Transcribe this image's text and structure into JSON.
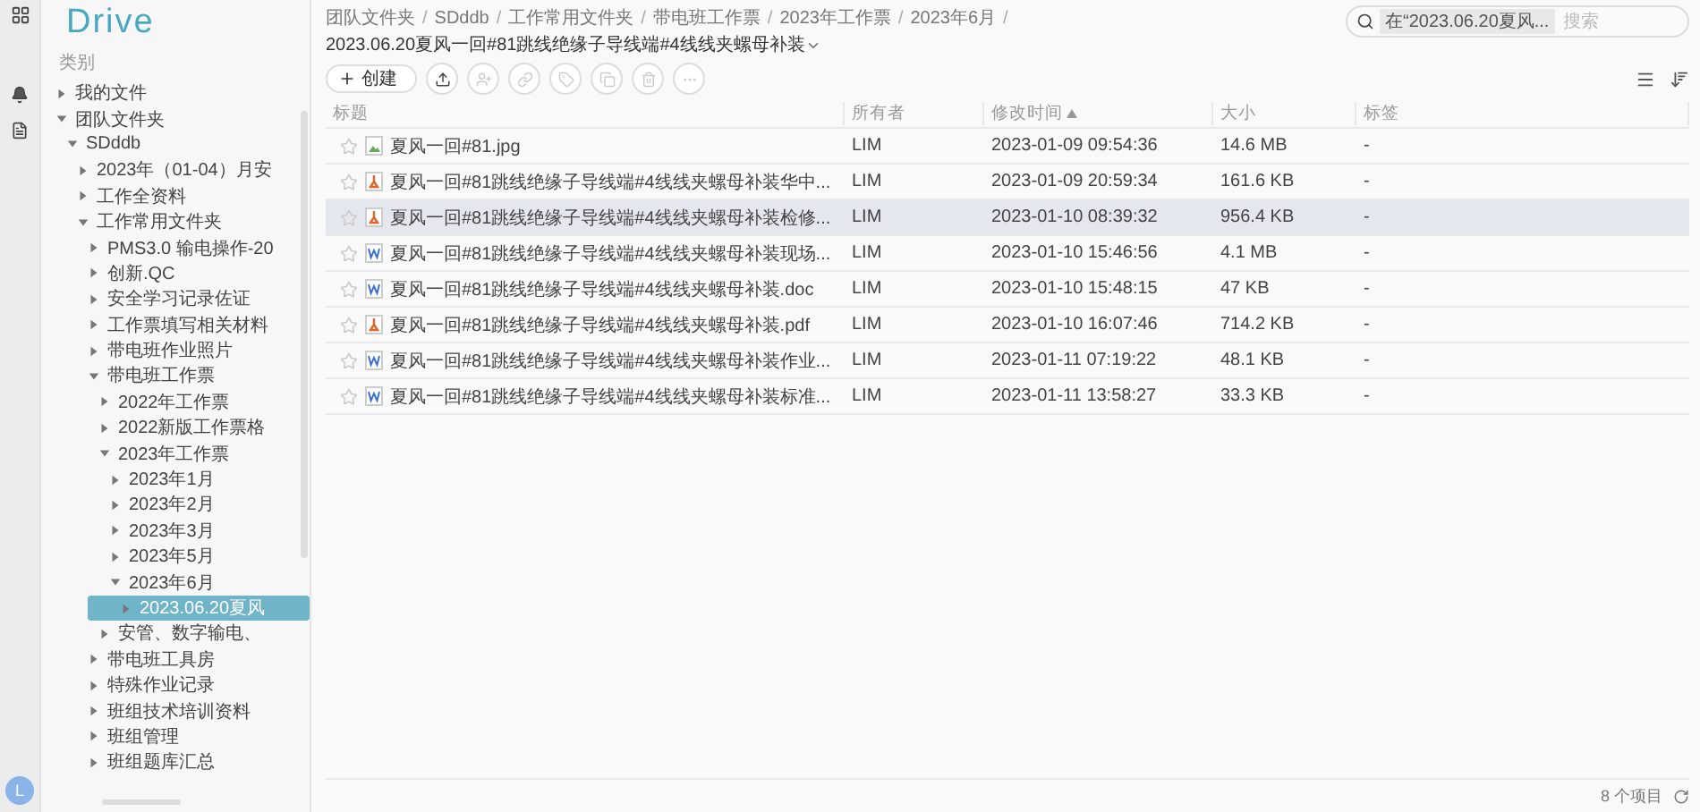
{
  "app": {
    "logo": "Drive"
  },
  "rail": {
    "avatar": "L"
  },
  "sidebar": {
    "heading": "类别",
    "tree": [
      {
        "label": "我的文件",
        "expanded": false,
        "selected": false
      },
      {
        "label": "团队文件夹",
        "expanded": true,
        "selected": false,
        "children": [
          {
            "label": "SDddb",
            "expanded": true,
            "selected": false,
            "children": [
              {
                "label": "2023年（01-04）月安",
                "expanded": false,
                "selected": false
              },
              {
                "label": "工作全资料",
                "expanded": false,
                "selected": false
              },
              {
                "label": "工作常用文件夹",
                "expanded": true,
                "selected": false,
                "children": [
                  {
                    "label": "PMS3.0 输电操作-20",
                    "expanded": false,
                    "selected": false
                  },
                  {
                    "label": "创新.QC",
                    "expanded": false,
                    "selected": false
                  },
                  {
                    "label": "安全学习记录佐证",
                    "expanded": false,
                    "selected": false
                  },
                  {
                    "label": "工作票填写相关材料",
                    "expanded": false,
                    "selected": false
                  },
                  {
                    "label": "带电班作业照片",
                    "expanded": false,
                    "selected": false
                  },
                  {
                    "label": "带电班工作票",
                    "expanded": true,
                    "selected": false,
                    "children": [
                      {
                        "label": "2022年工作票",
                        "expanded": false,
                        "selected": false
                      },
                      {
                        "label": "2022新版工作票格",
                        "expanded": false,
                        "selected": false
                      },
                      {
                        "label": "2023年工作票",
                        "expanded": true,
                        "selected": false,
                        "children": [
                          {
                            "label": "2023年1月",
                            "expanded": false,
                            "selected": false
                          },
                          {
                            "label": "2023年2月",
                            "expanded": false,
                            "selected": false
                          },
                          {
                            "label": "2023年3月",
                            "expanded": false,
                            "selected": false
                          },
                          {
                            "label": "2023年5月",
                            "expanded": false,
                            "selected": false
                          },
                          {
                            "label": "2023年6月",
                            "expanded": true,
                            "selected": false,
                            "children": [
                              {
                                "label": "2023.06.20夏风",
                                "expanded": false,
                                "selected": true
                              }
                            ]
                          }
                        ]
                      },
                      {
                        "label": "安管、数字输电、",
                        "expanded": false,
                        "selected": false
                      }
                    ]
                  },
                  {
                    "label": "带电班工具房",
                    "expanded": false,
                    "selected": false
                  },
                  {
                    "label": "特殊作业记录",
                    "expanded": false,
                    "selected": false
                  },
                  {
                    "label": "班组技术培训资料",
                    "expanded": false,
                    "selected": false
                  },
                  {
                    "label": "班组管理",
                    "expanded": false,
                    "selected": false
                  },
                  {
                    "label": "班组题库汇总",
                    "expanded": false,
                    "selected": false
                  }
                ]
              }
            ]
          }
        ]
      }
    ]
  },
  "breadcrumb": {
    "separator": "/",
    "items": [
      "团队文件夹",
      "SDddb",
      "工作常用文件夹",
      "带电班工作票",
      "2023年工作票",
      "2023年6月",
      "2023.06.20夏风一回#81跳线绝缘子导线端#4线线夹螺母补装"
    ]
  },
  "search": {
    "scope": "在“2023.06.20夏风...",
    "placeholder": "搜索"
  },
  "toolbar": {
    "create": "创建",
    "actions": [
      {
        "kind": "upload",
        "disabled": false
      },
      {
        "kind": "share",
        "disabled": true
      },
      {
        "kind": "link",
        "disabled": true
      },
      {
        "kind": "tag",
        "disabled": true
      },
      {
        "kind": "copy",
        "disabled": true
      },
      {
        "kind": "delete",
        "disabled": true
      },
      {
        "kind": "more",
        "disabled": true
      }
    ]
  },
  "table": {
    "columns": [
      {
        "label": "标题",
        "sorted": false
      },
      {
        "label": "所有者",
        "sorted": false
      },
      {
        "label": "修改时间",
        "sorted": true
      },
      {
        "label": "大小",
        "sorted": false
      },
      {
        "label": "标签",
        "sorted": false
      }
    ],
    "rows": [
      {
        "starred": false,
        "kind": "image",
        "title": "夏风一回#81.jpg",
        "owner": "LIM",
        "modified": "2023-01-09 09:54:36",
        "size": "14.6 MB",
        "tags": "-",
        "highlighted": false
      },
      {
        "starred": false,
        "kind": "pdf",
        "title": "夏风一回#81跳线绝缘子导线端#4线线夹螺母补装华中...",
        "owner": "LIM",
        "modified": "2023-01-09 20:59:34",
        "size": "161.6 KB",
        "tags": "-",
        "highlighted": false
      },
      {
        "starred": false,
        "kind": "pdf",
        "title": "夏风一回#81跳线绝缘子导线端#4线线夹螺母补装检修...",
        "owner": "LIM",
        "modified": "2023-01-10 08:39:32",
        "size": "956.4 KB",
        "tags": "-",
        "highlighted": true
      },
      {
        "starred": false,
        "kind": "word",
        "title": "夏风一回#81跳线绝缘子导线端#4线线夹螺母补装现场...",
        "owner": "LIM",
        "modified": "2023-01-10 15:46:56",
        "size": "4.1 MB",
        "tags": "-",
        "highlighted": false
      },
      {
        "starred": false,
        "kind": "word",
        "title": "夏风一回#81跳线绝缘子导线端#4线线夹螺母补装.doc",
        "owner": "LIM",
        "modified": "2023-01-10 15:48:15",
        "size": "47 KB",
        "tags": "-",
        "highlighted": false
      },
      {
        "starred": false,
        "kind": "pdf",
        "title": "夏风一回#81跳线绝缘子导线端#4线线夹螺母补装.pdf",
        "owner": "LIM",
        "modified": "2023-01-10 16:07:46",
        "size": "714.2 KB",
        "tags": "-",
        "highlighted": false
      },
      {
        "starred": false,
        "kind": "word",
        "title": "夏风一回#81跳线绝缘子导线端#4线线夹螺母补装作业...",
        "owner": "LIM",
        "modified": "2023-01-11 07:19:22",
        "size": "48.1 KB",
        "tags": "-",
        "highlighted": false
      },
      {
        "starred": false,
        "kind": "word",
        "title": "夏风一回#81跳线绝缘子导线端#4线线夹螺母补装标准...",
        "owner": "LIM",
        "modified": "2023-01-11 13:58:27",
        "size": "33.3 KB",
        "tags": "-",
        "highlighted": false
      }
    ]
  },
  "status_bar": {
    "count": "8 个项目"
  }
}
